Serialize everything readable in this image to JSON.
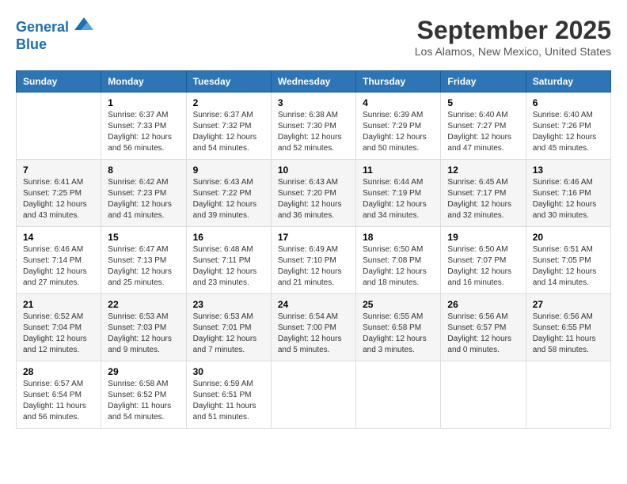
{
  "logo": {
    "line1": "General",
    "line2": "Blue"
  },
  "title": "September 2025",
  "location": "Los Alamos, New Mexico, United States",
  "weekdays": [
    "Sunday",
    "Monday",
    "Tuesday",
    "Wednesday",
    "Thursday",
    "Friday",
    "Saturday"
  ],
  "weeks": [
    [
      {
        "day": "",
        "sunrise": "",
        "sunset": "",
        "daylight": ""
      },
      {
        "day": "1",
        "sunrise": "Sunrise: 6:37 AM",
        "sunset": "Sunset: 7:33 PM",
        "daylight": "Daylight: 12 hours and 56 minutes."
      },
      {
        "day": "2",
        "sunrise": "Sunrise: 6:37 AM",
        "sunset": "Sunset: 7:32 PM",
        "daylight": "Daylight: 12 hours and 54 minutes."
      },
      {
        "day": "3",
        "sunrise": "Sunrise: 6:38 AM",
        "sunset": "Sunset: 7:30 PM",
        "daylight": "Daylight: 12 hours and 52 minutes."
      },
      {
        "day": "4",
        "sunrise": "Sunrise: 6:39 AM",
        "sunset": "Sunset: 7:29 PM",
        "daylight": "Daylight: 12 hours and 50 minutes."
      },
      {
        "day": "5",
        "sunrise": "Sunrise: 6:40 AM",
        "sunset": "Sunset: 7:27 PM",
        "daylight": "Daylight: 12 hours and 47 minutes."
      },
      {
        "day": "6",
        "sunrise": "Sunrise: 6:40 AM",
        "sunset": "Sunset: 7:26 PM",
        "daylight": "Daylight: 12 hours and 45 minutes."
      }
    ],
    [
      {
        "day": "7",
        "sunrise": "Sunrise: 6:41 AM",
        "sunset": "Sunset: 7:25 PM",
        "daylight": "Daylight: 12 hours and 43 minutes."
      },
      {
        "day": "8",
        "sunrise": "Sunrise: 6:42 AM",
        "sunset": "Sunset: 7:23 PM",
        "daylight": "Daylight: 12 hours and 41 minutes."
      },
      {
        "day": "9",
        "sunrise": "Sunrise: 6:43 AM",
        "sunset": "Sunset: 7:22 PM",
        "daylight": "Daylight: 12 hours and 39 minutes."
      },
      {
        "day": "10",
        "sunrise": "Sunrise: 6:43 AM",
        "sunset": "Sunset: 7:20 PM",
        "daylight": "Daylight: 12 hours and 36 minutes."
      },
      {
        "day": "11",
        "sunrise": "Sunrise: 6:44 AM",
        "sunset": "Sunset: 7:19 PM",
        "daylight": "Daylight: 12 hours and 34 minutes."
      },
      {
        "day": "12",
        "sunrise": "Sunrise: 6:45 AM",
        "sunset": "Sunset: 7:17 PM",
        "daylight": "Daylight: 12 hours and 32 minutes."
      },
      {
        "day": "13",
        "sunrise": "Sunrise: 6:46 AM",
        "sunset": "Sunset: 7:16 PM",
        "daylight": "Daylight: 12 hours and 30 minutes."
      }
    ],
    [
      {
        "day": "14",
        "sunrise": "Sunrise: 6:46 AM",
        "sunset": "Sunset: 7:14 PM",
        "daylight": "Daylight: 12 hours and 27 minutes."
      },
      {
        "day": "15",
        "sunrise": "Sunrise: 6:47 AM",
        "sunset": "Sunset: 7:13 PM",
        "daylight": "Daylight: 12 hours and 25 minutes."
      },
      {
        "day": "16",
        "sunrise": "Sunrise: 6:48 AM",
        "sunset": "Sunset: 7:11 PM",
        "daylight": "Daylight: 12 hours and 23 minutes."
      },
      {
        "day": "17",
        "sunrise": "Sunrise: 6:49 AM",
        "sunset": "Sunset: 7:10 PM",
        "daylight": "Daylight: 12 hours and 21 minutes."
      },
      {
        "day": "18",
        "sunrise": "Sunrise: 6:50 AM",
        "sunset": "Sunset: 7:08 PM",
        "daylight": "Daylight: 12 hours and 18 minutes."
      },
      {
        "day": "19",
        "sunrise": "Sunrise: 6:50 AM",
        "sunset": "Sunset: 7:07 PM",
        "daylight": "Daylight: 12 hours and 16 minutes."
      },
      {
        "day": "20",
        "sunrise": "Sunrise: 6:51 AM",
        "sunset": "Sunset: 7:05 PM",
        "daylight": "Daylight: 12 hours and 14 minutes."
      }
    ],
    [
      {
        "day": "21",
        "sunrise": "Sunrise: 6:52 AM",
        "sunset": "Sunset: 7:04 PM",
        "daylight": "Daylight: 12 hours and 12 minutes."
      },
      {
        "day": "22",
        "sunrise": "Sunrise: 6:53 AM",
        "sunset": "Sunset: 7:03 PM",
        "daylight": "Daylight: 12 hours and 9 minutes."
      },
      {
        "day": "23",
        "sunrise": "Sunrise: 6:53 AM",
        "sunset": "Sunset: 7:01 PM",
        "daylight": "Daylight: 12 hours and 7 minutes."
      },
      {
        "day": "24",
        "sunrise": "Sunrise: 6:54 AM",
        "sunset": "Sunset: 7:00 PM",
        "daylight": "Daylight: 12 hours and 5 minutes."
      },
      {
        "day": "25",
        "sunrise": "Sunrise: 6:55 AM",
        "sunset": "Sunset: 6:58 PM",
        "daylight": "Daylight: 12 hours and 3 minutes."
      },
      {
        "day": "26",
        "sunrise": "Sunrise: 6:56 AM",
        "sunset": "Sunset: 6:57 PM",
        "daylight": "Daylight: 12 hours and 0 minutes."
      },
      {
        "day": "27",
        "sunrise": "Sunrise: 6:56 AM",
        "sunset": "Sunset: 6:55 PM",
        "daylight": "Daylight: 11 hours and 58 minutes."
      }
    ],
    [
      {
        "day": "28",
        "sunrise": "Sunrise: 6:57 AM",
        "sunset": "Sunset: 6:54 PM",
        "daylight": "Daylight: 11 hours and 56 minutes."
      },
      {
        "day": "29",
        "sunrise": "Sunrise: 6:58 AM",
        "sunset": "Sunset: 6:52 PM",
        "daylight": "Daylight: 11 hours and 54 minutes."
      },
      {
        "day": "30",
        "sunrise": "Sunrise: 6:59 AM",
        "sunset": "Sunset: 6:51 PM",
        "daylight": "Daylight: 11 hours and 51 minutes."
      },
      {
        "day": "",
        "sunrise": "",
        "sunset": "",
        "daylight": ""
      },
      {
        "day": "",
        "sunrise": "",
        "sunset": "",
        "daylight": ""
      },
      {
        "day": "",
        "sunrise": "",
        "sunset": "",
        "daylight": ""
      },
      {
        "day": "",
        "sunrise": "",
        "sunset": "",
        "daylight": ""
      }
    ]
  ]
}
